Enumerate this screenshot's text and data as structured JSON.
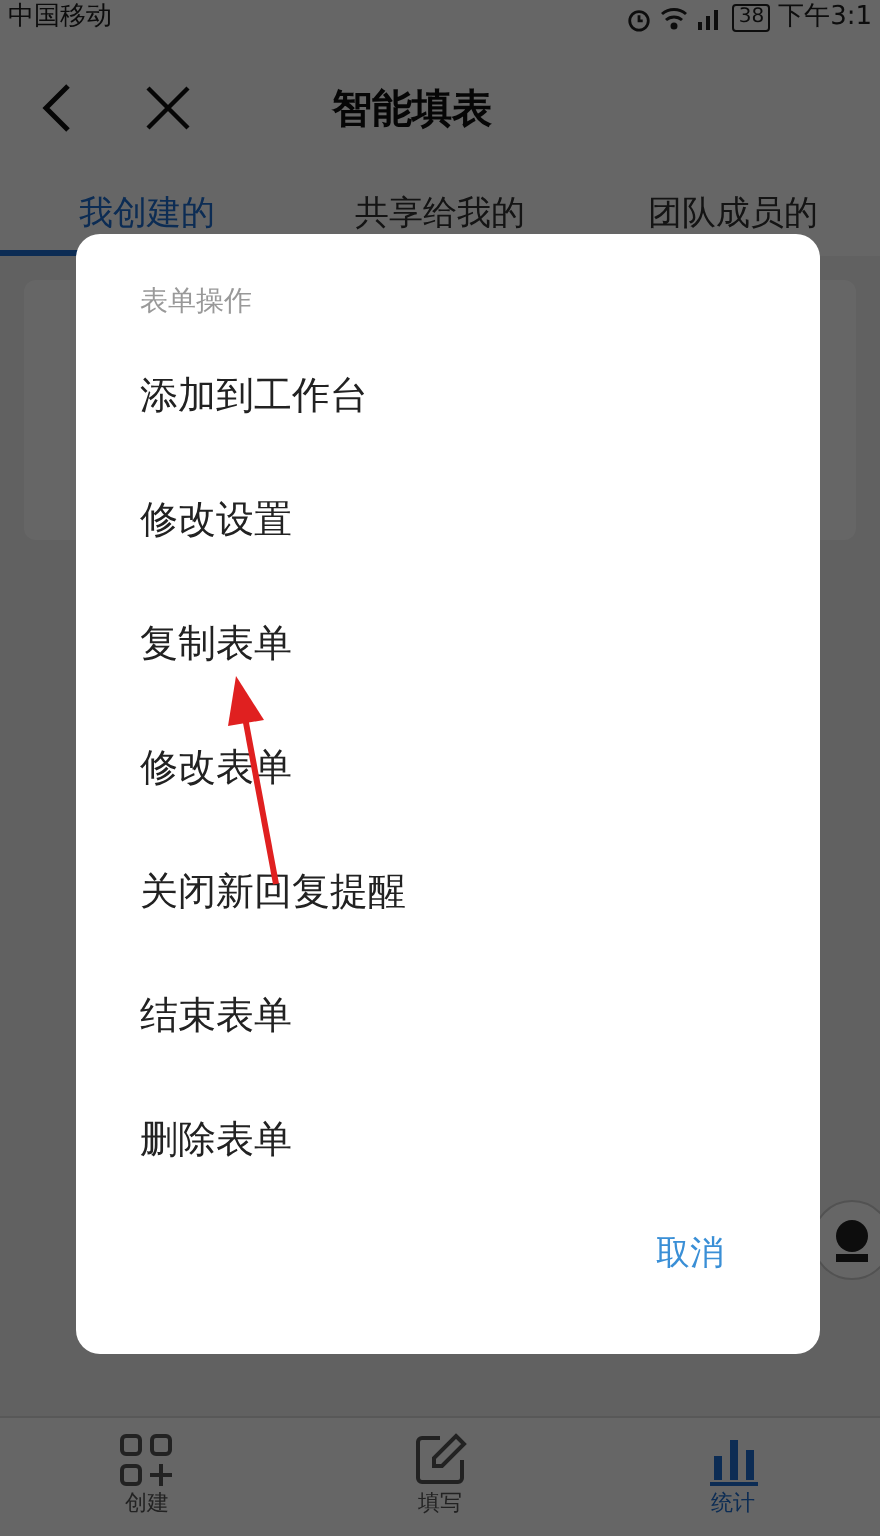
{
  "status_bar": {
    "carrier": "中国移动",
    "battery": "38",
    "time": "下午3:1"
  },
  "header": {
    "title": "智能填表"
  },
  "tabs": [
    {
      "label": "我创建的",
      "selected": true
    },
    {
      "label": "共享给我的",
      "selected": false
    },
    {
      "label": "团队成员的",
      "selected": false
    }
  ],
  "dialog": {
    "title": "表单操作",
    "items": [
      "添加到工作台",
      "修改设置",
      "复制表单",
      "修改表单",
      "关闭新回复提醒",
      "结束表单",
      "删除表单"
    ],
    "cancel": "取消"
  },
  "bottom_nav": [
    {
      "label": "创建",
      "kind": "create",
      "selected": false
    },
    {
      "label": "填写",
      "kind": "fill",
      "selected": false
    },
    {
      "label": "统计",
      "kind": "stats",
      "selected": true
    }
  ]
}
